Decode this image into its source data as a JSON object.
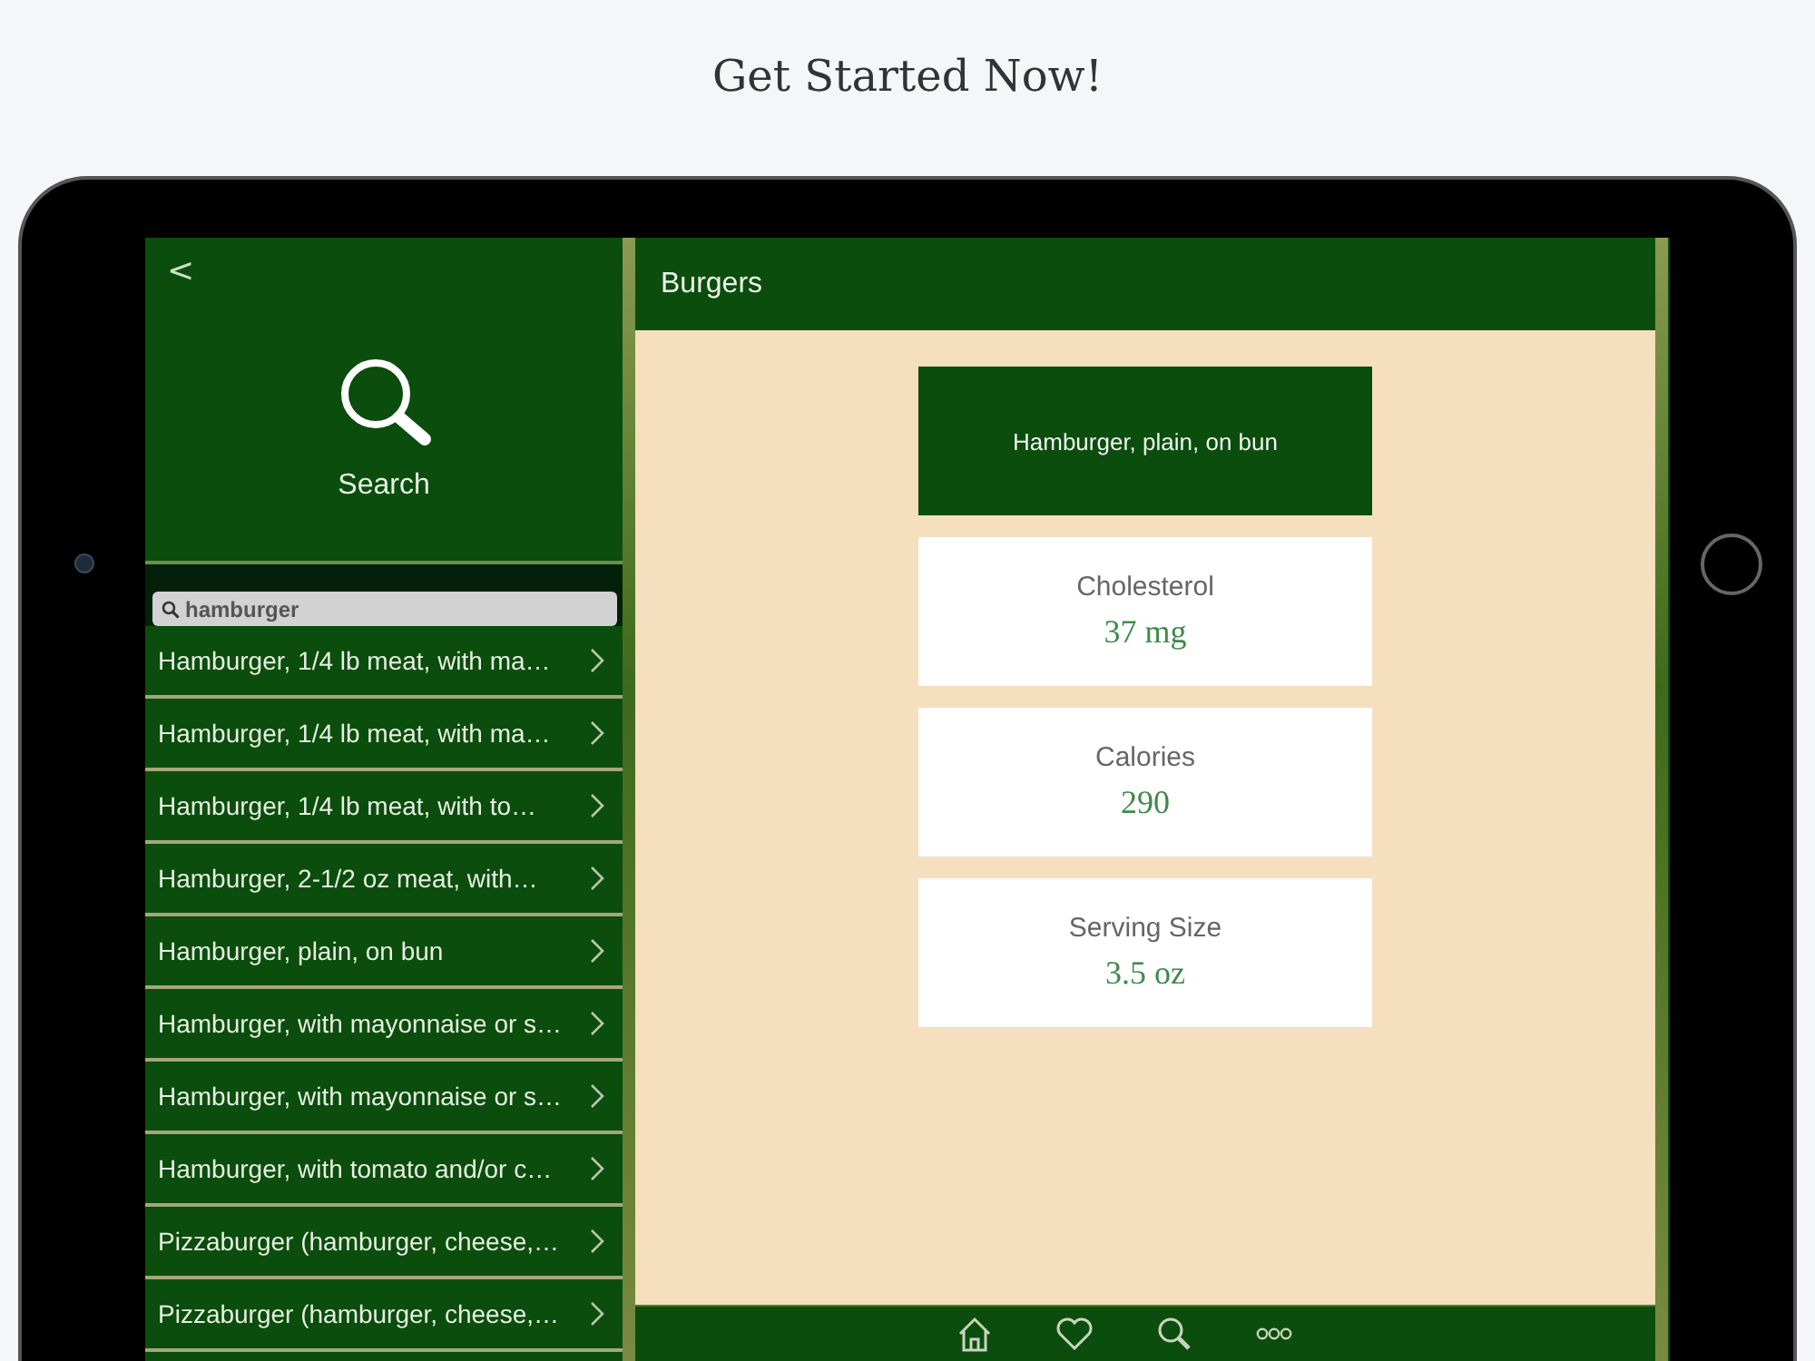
{
  "heading": "Get Started Now!",
  "sidebar": {
    "back": "<",
    "title": "Search",
    "search": {
      "value": "hamburger"
    },
    "items": [
      {
        "label": "Hamburger, 1/4 lb meat, with ma…"
      },
      {
        "label": "Hamburger, 1/4 lb meat, with ma…"
      },
      {
        "label": "Hamburger, 1/4 lb meat, with to…"
      },
      {
        "label": "Hamburger, 2-1/2 oz meat, with…"
      },
      {
        "label": "Hamburger, plain, on bun"
      },
      {
        "label": "Hamburger, with mayonnaise or s…"
      },
      {
        "label": "Hamburger, with mayonnaise or s…"
      },
      {
        "label": "Hamburger, with tomato and/or c…"
      },
      {
        "label": "Pizzaburger (hamburger, cheese,…"
      },
      {
        "label": "Pizzaburger (hamburger, cheese,…"
      }
    ]
  },
  "detail": {
    "title": "Burgers",
    "name": "Hamburger, plain, on bun",
    "facts": [
      {
        "label": "Cholesterol",
        "value": "37 mg"
      },
      {
        "label": "Calories",
        "value": "290"
      },
      {
        "label": "Serving Size",
        "value": "3.5 oz"
      }
    ]
  },
  "tab_bar": [
    {
      "kind": "home"
    },
    {
      "kind": "favorites"
    },
    {
      "kind": "search"
    },
    {
      "kind": "more"
    }
  ]
}
